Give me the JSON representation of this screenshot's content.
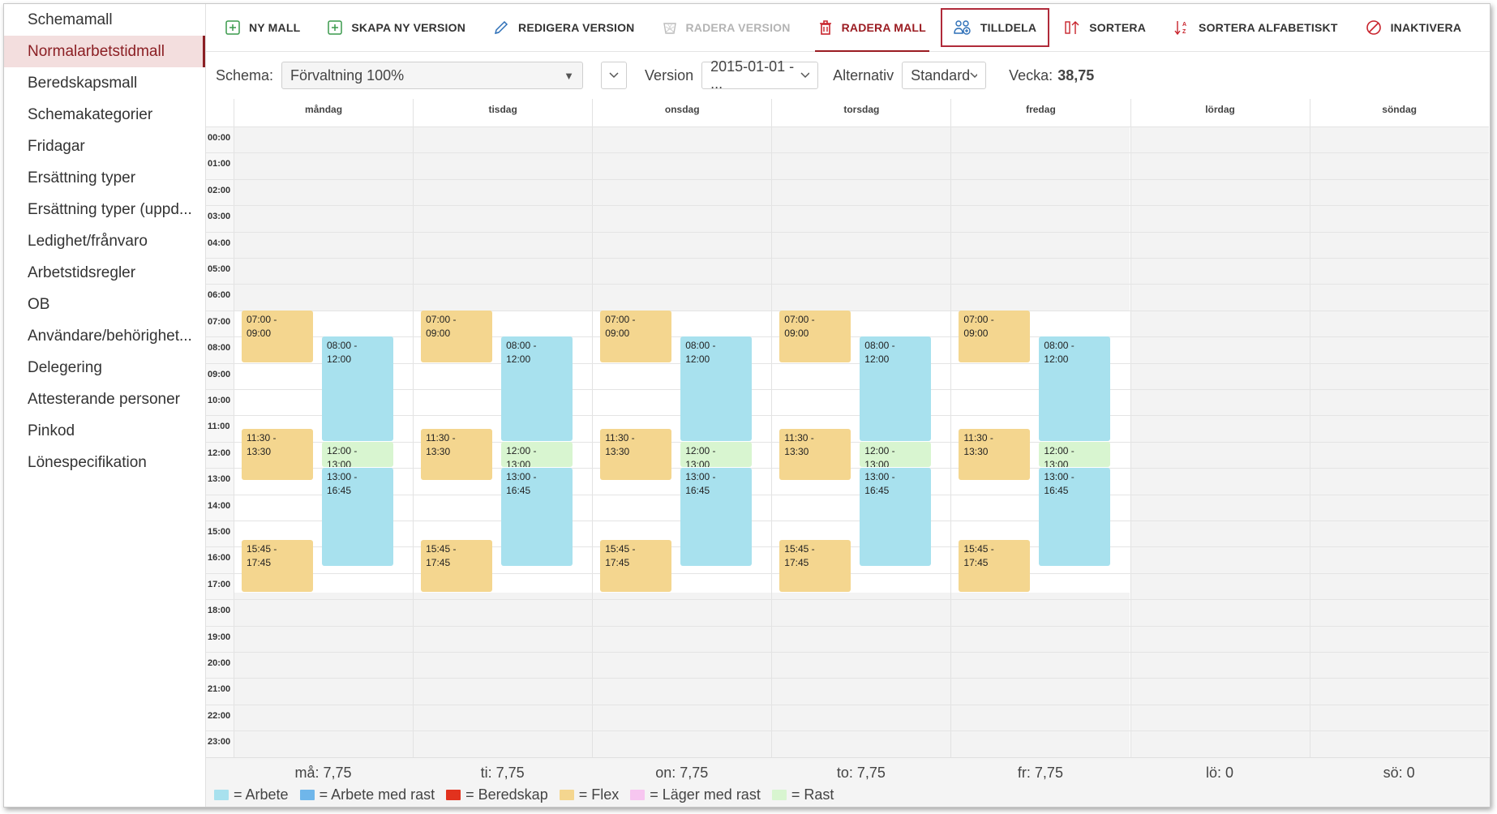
{
  "sidebar": {
    "items": [
      {
        "label": "Schemamall",
        "active": false
      },
      {
        "label": "Normalarbetstidmall",
        "active": true
      },
      {
        "label": "Beredskapsmall",
        "active": false
      },
      {
        "label": "Schemakategorier",
        "active": false
      },
      {
        "label": "Fridagar",
        "active": false
      },
      {
        "label": "Ersättning typer",
        "active": false
      },
      {
        "label": "Ersättning typer (uppd...",
        "active": false
      },
      {
        "label": "Ledighet/frånvaro",
        "active": false
      },
      {
        "label": "Arbetstidsregler",
        "active": false
      },
      {
        "label": "OB",
        "active": false
      },
      {
        "label": "Användare/behörighet...",
        "active": false
      },
      {
        "label": "Delegering",
        "active": false
      },
      {
        "label": "Attesterande personer",
        "active": false
      },
      {
        "label": "Pinkod",
        "active": false
      },
      {
        "label": "Lönespecifikation",
        "active": false
      }
    ]
  },
  "toolbar": {
    "buttons": [
      {
        "label": "NY MALL",
        "icon": "plus-box-icon",
        "state": "normal"
      },
      {
        "label": "SKAPA NY VERSION",
        "icon": "plus-box-icon",
        "state": "normal"
      },
      {
        "label": "REDIGERA VERSION",
        "icon": "pencil-icon",
        "state": "normal"
      },
      {
        "label": "RADERA VERSION",
        "icon": "trash-basket-icon",
        "state": "disabled"
      },
      {
        "label": "RADERA MALL",
        "icon": "trash-icon",
        "state": "danger"
      },
      {
        "label": "TILLDELA",
        "icon": "assign-users-icon",
        "state": "highlight"
      },
      {
        "label": "SORTERA",
        "icon": "sort-icon",
        "state": "normal"
      },
      {
        "label": "SORTERA ALFABETISKT",
        "icon": "sort-alpha-icon",
        "state": "normal"
      },
      {
        "label": "INAKTIVERA",
        "icon": "block-icon",
        "state": "normal"
      }
    ]
  },
  "filters": {
    "schema_label": "Schema:",
    "schema_value": "Förvaltning 100%",
    "version_label": "Version",
    "version_value": "2015-01-01 - ...",
    "alternativ_label": "Alternativ",
    "alternativ_value": "Standard",
    "vecka_label": "Vecka:",
    "vecka_value": "38,75"
  },
  "calendar": {
    "days": [
      "måndag",
      "tisdag",
      "onsdag",
      "torsdag",
      "fredag",
      "lördag",
      "söndag"
    ],
    "hours": [
      "00:00",
      "01:00",
      "02:00",
      "03:00",
      "04:00",
      "05:00",
      "06:00",
      "07:00",
      "08:00",
      "09:00",
      "10:00",
      "11:00",
      "12:00",
      "13:00",
      "14:00",
      "15:00",
      "16:00",
      "17:00",
      "18:00",
      "19:00",
      "20:00",
      "21:00",
      "22:00",
      "23:00"
    ],
    "working_hours": [
      7,
      17.75
    ],
    "working_days": 5,
    "blocks": [
      {
        "lane": 0,
        "start": 7.0,
        "end": 9.0,
        "label": "07:00 -\n09:00",
        "type": "Flex"
      },
      {
        "lane": 0,
        "start": 11.5,
        "end": 13.5,
        "label": "11:30 -\n13:30",
        "type": "Flex"
      },
      {
        "lane": 0,
        "start": 15.75,
        "end": 17.75,
        "label": "15:45 -\n17:45",
        "type": "Flex"
      },
      {
        "lane": 1,
        "start": 8.0,
        "end": 12.0,
        "label": "08:00 -\n12:00",
        "type": "Arbete"
      },
      {
        "lane": 1,
        "start": 12.0,
        "end": 13.0,
        "label": "12:00 -\n13:00",
        "type": "Rast"
      },
      {
        "lane": 1,
        "start": 13.0,
        "end": 16.75,
        "label": "13:00 -\n16:45",
        "type": "Arbete"
      }
    ]
  },
  "footer": {
    "totals": [
      "må: 7,75",
      "ti: 7,75",
      "on: 7,75",
      "to: 7,75",
      "fr: 7,75",
      "lö: 0",
      "sö: 0"
    ],
    "legend": [
      {
        "label": "= Arbete",
        "color": "#a8e1ee"
      },
      {
        "label": "= Arbete med rast",
        "color": "#6fb6ea"
      },
      {
        "label": "= Beredskap",
        "color": "#e2321e"
      },
      {
        "label": "= Flex",
        "color": "#f4d68f"
      },
      {
        "label": "= Läger med rast",
        "color": "#f7c6f0"
      },
      {
        "label": "= Rast",
        "color": "#d8f5d0"
      }
    ]
  },
  "colors": {
    "Arbete": "#a8e1ee",
    "Flex": "#f4d68f",
    "Rast": "#d8f5d0",
    "accent": "#8b1f24",
    "offhours": "#f3f3f3"
  }
}
